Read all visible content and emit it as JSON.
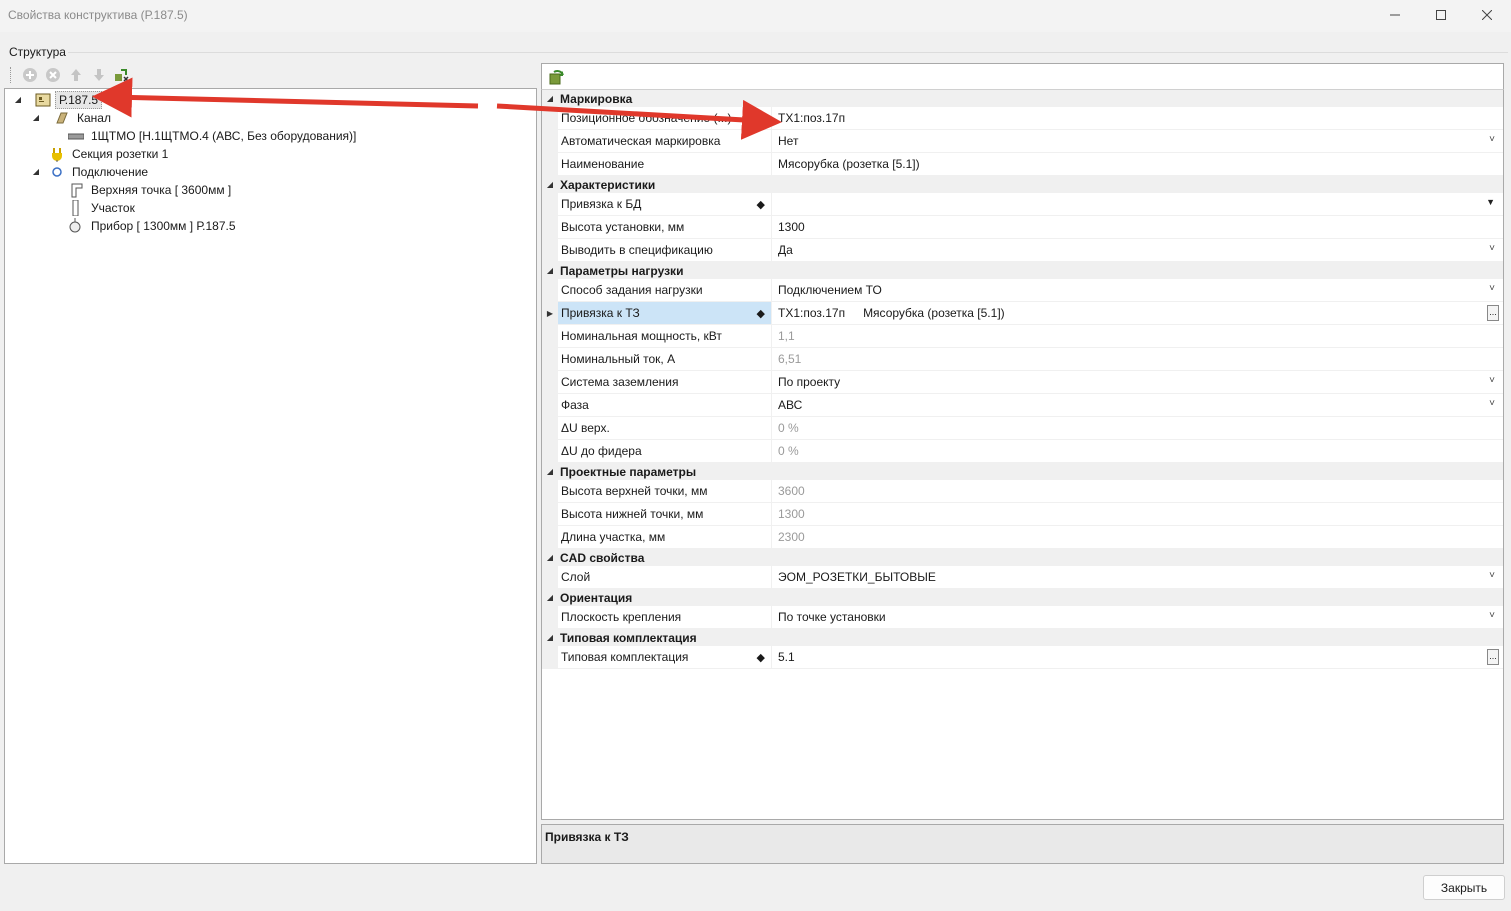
{
  "window": {
    "title": "Свойства конструктива (Р.187.5)"
  },
  "structure": {
    "group_label": "Структура",
    "tree": [
      {
        "label": "Р.187.5",
        "icon": "device-square-icon"
      },
      {
        "label": "Канал",
        "icon": "channel-icon"
      },
      {
        "label": "1ЩТМО [Н.1ЩТМО.4 (АВС, Без оборудования)]",
        "icon": "panel-icon"
      },
      {
        "label": "Секция розетки 1",
        "icon": "socket-plug-icon"
      },
      {
        "label": "Подключение",
        "icon": "circle-icon"
      },
      {
        "label": "Верхняя точка [ 3600мм ]",
        "icon": "corner-icon"
      },
      {
        "label": "Участок",
        "icon": "segment-icon"
      },
      {
        "label": "Прибор [ 1300мм ] Р.187.5",
        "icon": "bulb-icon"
      }
    ]
  },
  "properties": {
    "categories": [
      {
        "name": "Маркировка",
        "rows": [
          {
            "name": "Позиционное обозначение (...)",
            "value": "ТХ1:поз.17п"
          },
          {
            "name": "Автоматическая маркировка",
            "value": "Нет"
          },
          {
            "name": "Наименование",
            "value": "Мясорубка (розетка [5.1])"
          }
        ]
      },
      {
        "name": "Характеристики",
        "rows": [
          {
            "name": "Привязка к БД",
            "value": ""
          },
          {
            "name": "Высота установки, мм",
            "value": "1300"
          },
          {
            "name": "Выводить в спецификацию",
            "value": "Да"
          }
        ]
      },
      {
        "name": "Параметры нагрузки",
        "rows": [
          {
            "name": "Способ задания нагрузки",
            "value": "Подключением ТО"
          },
          {
            "name": "Привязка к ТЗ",
            "value": "ТХ1:поз.17п",
            "value2": "Мясорубка (розетка [5.1])"
          },
          {
            "name": "Номинальная мощность, кВт",
            "value": "1,1"
          },
          {
            "name": "Номинальный ток, А",
            "value": "6,51"
          },
          {
            "name": "Система заземления",
            "value": "По проекту"
          },
          {
            "name": "Фаза",
            "value": "АВС"
          },
          {
            "name": "ΔU верх.",
            "value": "0 %"
          },
          {
            "name": "ΔU до фидера",
            "value": "0 %"
          }
        ]
      },
      {
        "name": "Проектные параметры",
        "rows": [
          {
            "name": "Высота верхней точки, мм",
            "value": "3600"
          },
          {
            "name": "Высота нижней точки, мм",
            "value": "1300"
          },
          {
            "name": "Длина участка, мм",
            "value": "2300"
          }
        ]
      },
      {
        "name": "CAD свойства",
        "rows": [
          {
            "name": "Слой",
            "value": "ЭОМ_РОЗЕТКИ_БЫТОВЫЕ"
          }
        ]
      },
      {
        "name": "Ориентация",
        "rows": [
          {
            "name": "Плоскость крепления",
            "value": "По точке установки"
          }
        ]
      },
      {
        "name": "Типовая комплектация",
        "rows": [
          {
            "name": "Типовая комплектация",
            "value": "5.1"
          }
        ]
      }
    ]
  },
  "description": {
    "title": "Привязка к ТЗ"
  },
  "buttons": {
    "close": "Закрыть"
  },
  "colors": {
    "arrow": "#e0382b",
    "selection": "#cce4f7"
  }
}
